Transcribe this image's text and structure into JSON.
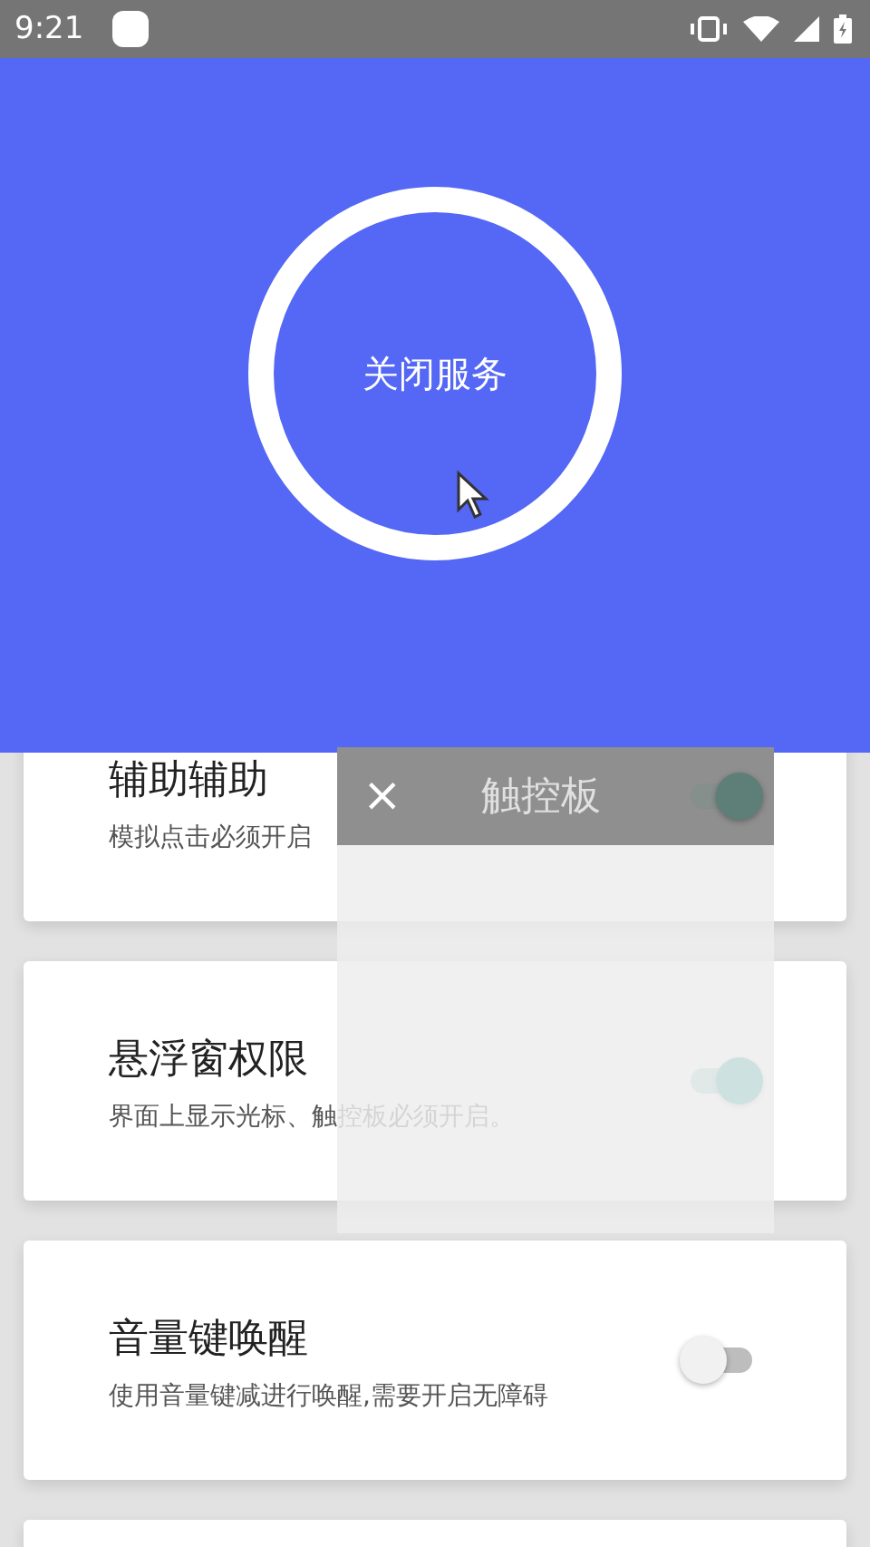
{
  "status_bar": {
    "time": "9:21"
  },
  "service_button": {
    "label": "关闭服务"
  },
  "settings": [
    {
      "title": "辅助辅助",
      "description": "模拟点击必须开启"
    },
    {
      "title": "悬浮窗权限",
      "description": "界面上显示光标、触控板必须开启。",
      "on": true
    },
    {
      "title": "音量键唤醒",
      "description": "使用音量键减进行唤醒,需要开启无障碍",
      "on": false
    }
  ],
  "touchpad_panel": {
    "close": "×",
    "title": "触控板",
    "on": true
  }
}
